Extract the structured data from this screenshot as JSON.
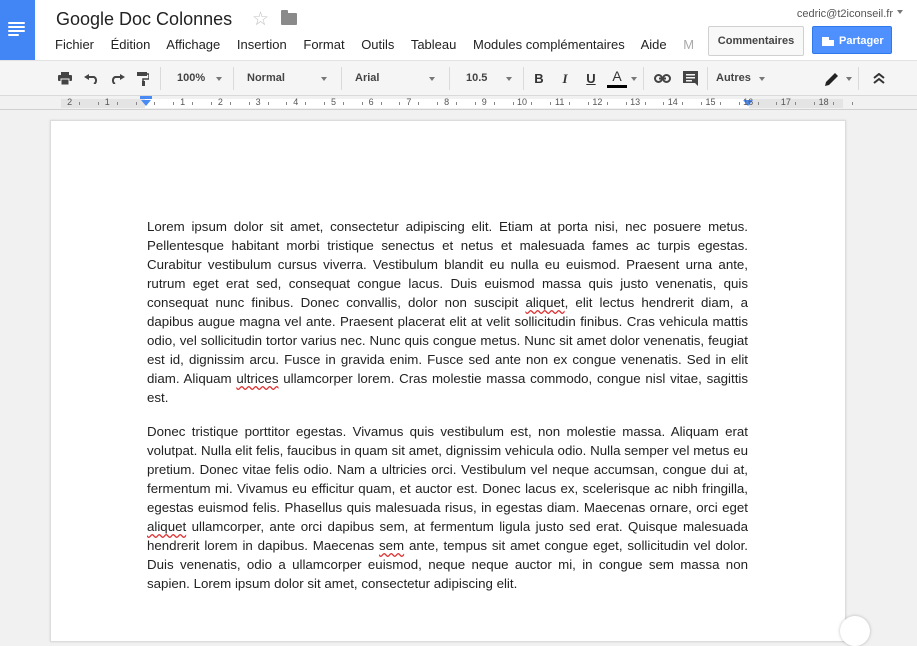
{
  "header": {
    "doc_title": "Google Doc Colonnes",
    "user_email": "cedric@t2iconseil.fr",
    "comments_button": "Commentaires",
    "share_button": "Partager"
  },
  "menu": {
    "items": [
      "Fichier",
      "Édition",
      "Affichage",
      "Insertion",
      "Format",
      "Outils",
      "Tableau",
      "Modules complémentaires",
      "Aide"
    ],
    "overflow_item": "M"
  },
  "toolbar": {
    "zoom": "100%",
    "style": "Normal",
    "font": "Arial",
    "font_size": "10.5",
    "bold": "B",
    "italic": "I",
    "underline": "U",
    "text_color": "A",
    "more": "Autres",
    "text_color_swatch": "#000000"
  },
  "ruler": {
    "labels": [
      "2",
      "1",
      "1",
      "2",
      "3",
      "4",
      "5",
      "6",
      "7",
      "8",
      "9",
      "10",
      "11",
      "12",
      "13",
      "14",
      "15",
      "16",
      "17",
      "18"
    ]
  },
  "document": {
    "paragraph_1": [
      {
        "t": "Lorem ipsum dolor sit amet, consectetur adipiscing elit. Etiam at porta nisi, nec posuere metus. Pellentesque habitant morbi tristique senectus et netus et malesuada fames ac turpis egestas. Curabitur vestibulum cursus viverra. Vestibulum blandit eu nulla eu euismod. Praesent urna ante, rutrum eget erat sed, consequat congue lacus. Duis euismod massa quis justo venenatis, quis consequat nunc finibus. Donec convallis, dolor non suscipit "
      },
      {
        "t": "aliquet",
        "sq": true
      },
      {
        "t": ", elit lectus hendrerit diam, a dapibus augue magna vel ante. Praesent placerat elit at velit sollicitudin finibus. Cras vehicula mattis odio, vel sollicitudin tortor varius nec. Nunc quis congue metus. Nunc sit amet dolor venenatis, feugiat est id, dignissim arcu. Fusce in gravida enim. Fusce sed ante non ex congue venenatis. Sed in elit diam. Aliquam "
      },
      {
        "t": "ultrices",
        "sq": true
      },
      {
        "t": " ullamcorper lorem. Cras molestie massa commodo, congue nisl vitae, sagittis est."
      }
    ],
    "paragraph_2": [
      {
        "t": "Donec tristique porttitor egestas. Vivamus quis vestibulum est, non molestie massa. Aliquam erat volutpat. Nulla elit felis, faucibus in quam sit amet, dignissim vehicula odio. Nulla semper vel metus eu pretium. Donec vitae felis odio. Nam a ultricies orci. Vestibulum vel neque accumsan, congue dui at, fermentum mi. Vivamus eu efficitur quam, et auctor est. Donec lacus ex, scelerisque ac nibh fringilla, egestas euismod felis. Phasellus quis malesuada risus, in egestas diam. Maecenas ornare, orci eget "
      },
      {
        "t": "aliquet",
        "sq": true
      },
      {
        "t": " ullamcorper, ante orci dapibus sem, at fermentum ligula justo sed erat. Quisque malesuada hendrerit lorem in dapibus. Maecenas "
      },
      {
        "t": "sem",
        "sq": true
      },
      {
        "t": " ante, tempus sit amet congue eget, sollicitudin vel dolor. Duis venenatis, odio a ullamcorper euismod, neque neque auctor mi, in congue sem massa non sapien. Lorem ipsum dolor sit amet, consectetur adipiscing elit."
      }
    ]
  },
  "colors": {
    "brand_blue": "#4285f4",
    "share_blue": "#4d90fe",
    "spellcheck_red": "#dd3333"
  }
}
